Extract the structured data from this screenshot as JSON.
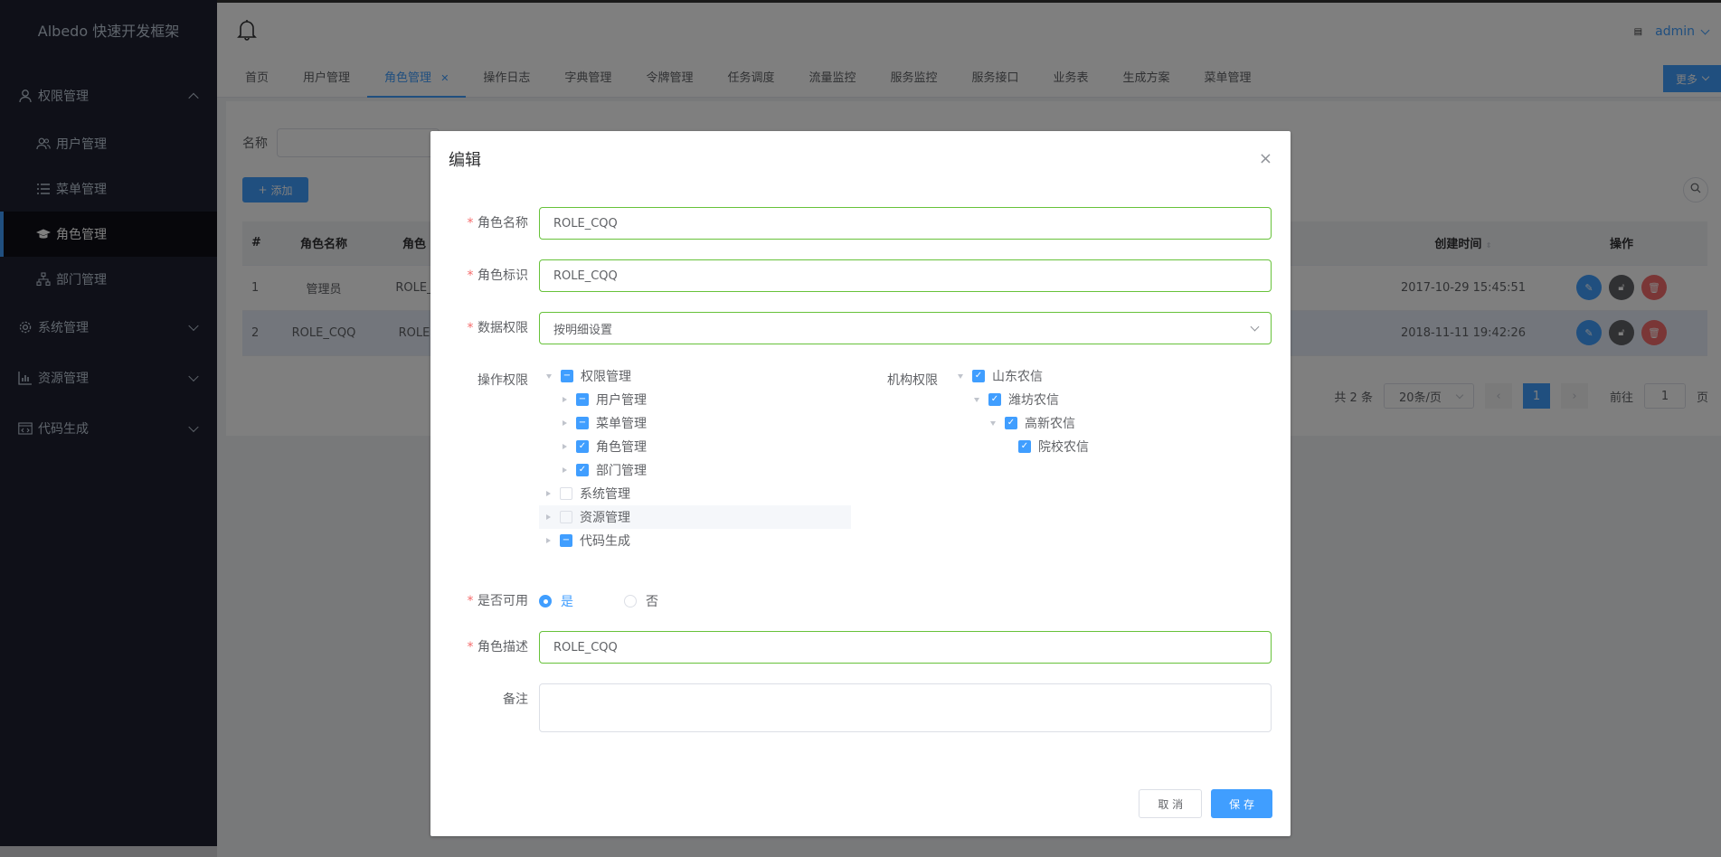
{
  "app_title": "Albedo 快速开发框架",
  "user": "admin",
  "sidebar": {
    "items": [
      {
        "label": "权限管理",
        "icon": "user-icon"
      },
      {
        "label": "用户管理",
        "icon": "users-icon"
      },
      {
        "label": "菜单管理",
        "icon": "list-icon"
      },
      {
        "label": "角色管理",
        "icon": "graduation-cap-icon"
      },
      {
        "label": "部门管理",
        "icon": "sitemap-icon"
      },
      {
        "label": "系统管理",
        "icon": "gear-icon"
      },
      {
        "label": "资源管理",
        "icon": "bar-chart-icon"
      },
      {
        "label": "代码生成",
        "icon": "code-icon"
      }
    ]
  },
  "tabs": [
    "首页",
    "用户管理",
    "角色管理",
    "操作日志",
    "字典管理",
    "令牌管理",
    "任务调度",
    "流量监控",
    "服务监控",
    "服务接口",
    "业务表",
    "生成方案",
    "菜单管理"
  ],
  "more_label": "更多",
  "filter": {
    "name_label": "名称"
  },
  "add_label": "添加",
  "table": {
    "headers": [
      "#",
      "角色名称",
      "角色",
      "创建时间",
      "操作"
    ],
    "rows": [
      {
        "idx": "1",
        "name": "管理员",
        "code": "ROLE_",
        "created": "2017-10-29 15:45:51"
      },
      {
        "idx": "2",
        "name": "ROLE_CQQ",
        "code": "ROLE",
        "created": "2018-11-11 19:42:26"
      }
    ]
  },
  "pager": {
    "total": "共 2 条",
    "size": "20条/页",
    "page": "1",
    "goto": "前往",
    "goto_val": "1",
    "page_unit": "页"
  },
  "dialog": {
    "title": "编辑",
    "close": "×",
    "role_name_label": "角色名称",
    "role_name": "ROLE_CQQ",
    "role_code_label": "角色标识",
    "role_code": "ROLE_CQQ",
    "data_scope_label": "数据权限",
    "data_scope": "按明细设置",
    "op_perm_label": "操作权限",
    "op_tree": [
      {
        "label": "权限管理",
        "state": "partial"
      },
      {
        "label": "用户管理",
        "state": "partial"
      },
      {
        "label": "菜单管理",
        "state": "partial"
      },
      {
        "label": "角色管理",
        "state": "checked"
      },
      {
        "label": "部门管理",
        "state": "checked"
      },
      {
        "label": "系统管理",
        "state": "unchecked"
      },
      {
        "label": "资源管理",
        "state": "unchecked"
      },
      {
        "label": "代码生成",
        "state": "partial"
      }
    ],
    "org_perm_label": "机构权限",
    "org_tree": [
      {
        "label": "山东农信",
        "state": "checked"
      },
      {
        "label": "潍坊农信",
        "state": "checked"
      },
      {
        "label": "高新农信",
        "state": "checked"
      },
      {
        "label": "院校农信",
        "state": "checked"
      }
    ],
    "available_label": "是否可用",
    "yes": "是",
    "no": "否",
    "desc_label": "角色描述",
    "desc": "ROLE_CQQ",
    "remark_label": "备注",
    "cancel": "取 消",
    "save": "保 存"
  },
  "colors": {
    "primary": "#409eff",
    "valid": "#67c23a",
    "danger": "#f56c6c"
  }
}
